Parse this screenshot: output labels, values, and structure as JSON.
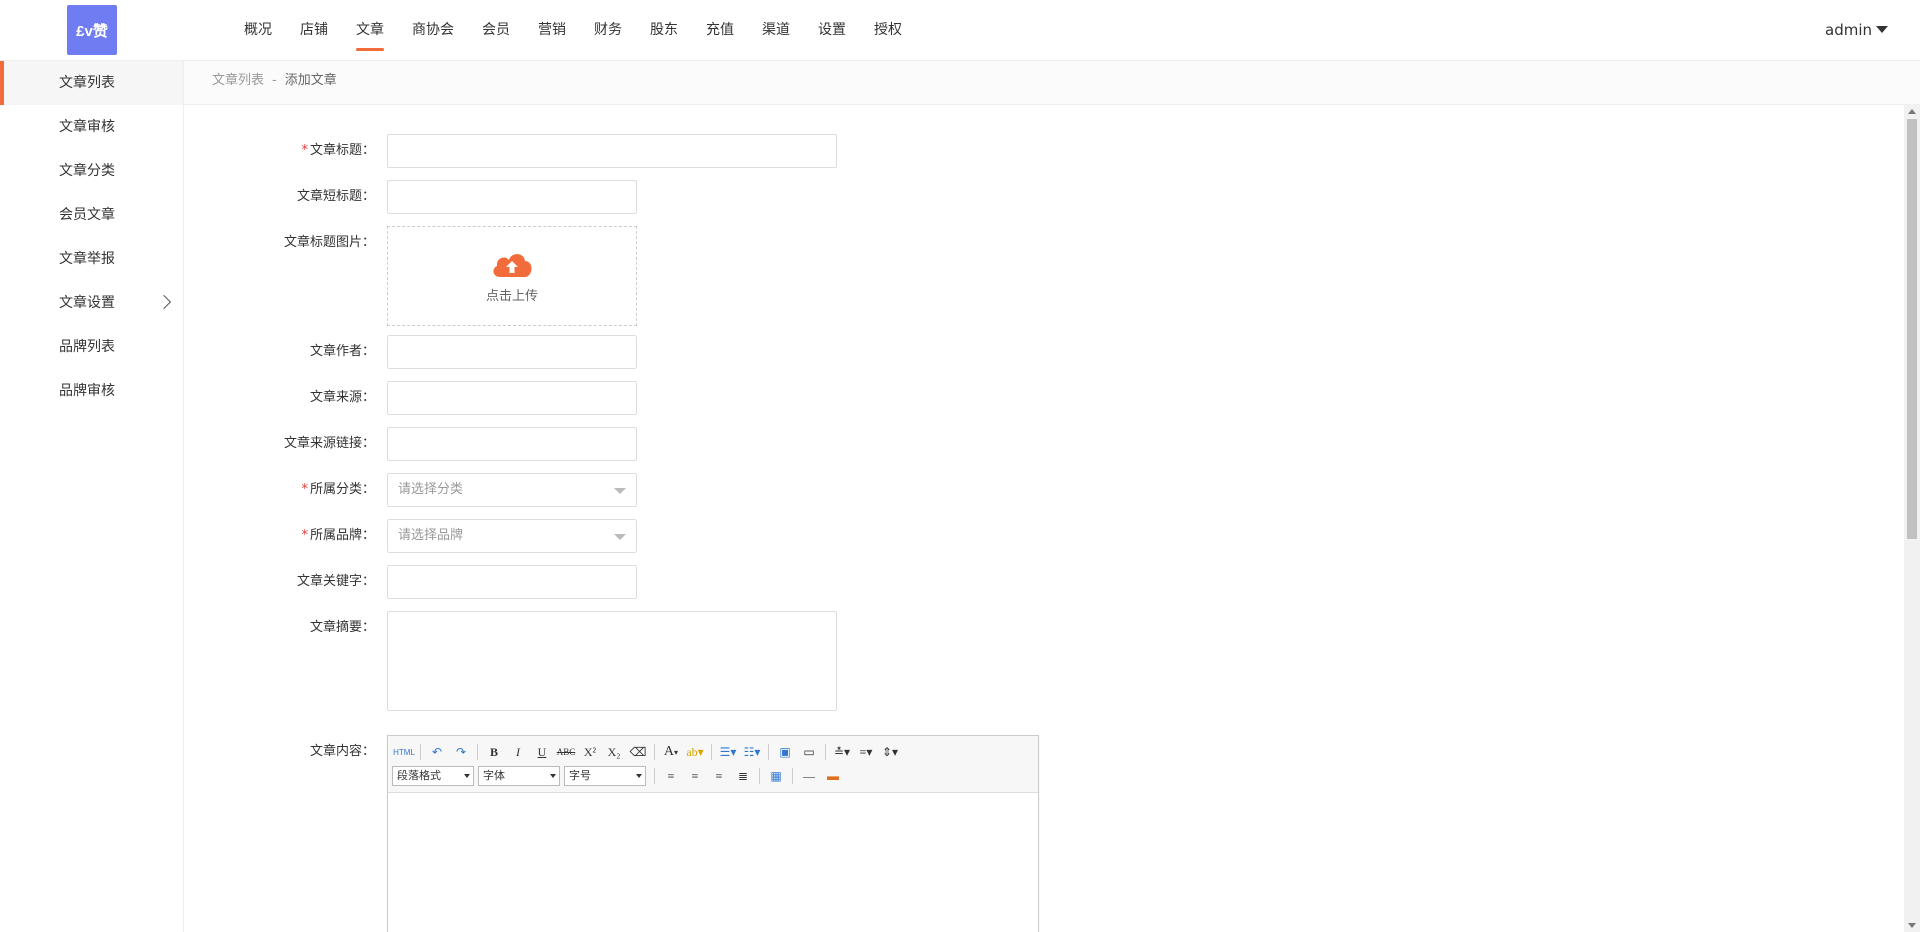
{
  "app": {
    "logo_text": "£v赞",
    "user": "admin"
  },
  "nav": [
    "概况",
    "店铺",
    "文章",
    "商协会",
    "会员",
    "营销",
    "财务",
    "股东",
    "充值",
    "渠道",
    "设置",
    "授权"
  ],
  "sidebar": [
    "文章列表",
    "文章审核",
    "文章分类",
    "会员文章",
    "文章举报",
    "文章设置",
    "品牌列表",
    "品牌审核"
  ],
  "breadcrumb": {
    "parent": "文章列表",
    "sep": "-",
    "current": "添加文章"
  },
  "form": {
    "title": "文章标题：",
    "short_title": "文章短标题：",
    "image": "文章标题图片：",
    "upload": "点击上传",
    "author": "文章作者：",
    "source": "文章来源：",
    "source_link": "文章来源链接：",
    "category": "所属分类：",
    "category_ph": "请选择分类",
    "brand": "所属品牌：",
    "brand_ph": "请选择品牌",
    "keywords": "文章关键字：",
    "summary": "文章摘要：",
    "content": "文章内容：",
    "required_mark": "*"
  },
  "editor": {
    "html": "HTML",
    "bold": "B",
    "italic": "I",
    "underline": "U",
    "strike": "ABC",
    "sup": "X²",
    "sub": "X₂",
    "fontcolor": "A",
    "para": "段落格式",
    "font": "字体",
    "size": "字号"
  },
  "colors": {
    "accent": "#f26b3a",
    "logo_bg": "#6f7cf2"
  }
}
